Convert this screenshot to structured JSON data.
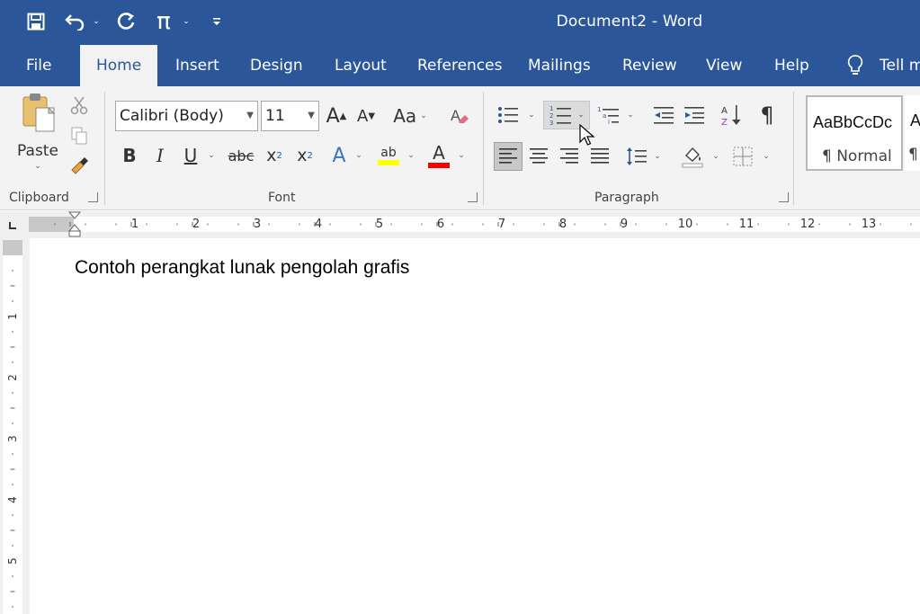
{
  "window": {
    "title": "Document2  -  Word",
    "accent": "#2b579a"
  },
  "qat": {
    "save_icon": "save-icon",
    "undo_icon": "undo-icon",
    "redo_icon": "repeat-icon",
    "equation_label": "π",
    "customize_icon": "customize-qat-icon"
  },
  "tabs": [
    {
      "label": "File"
    },
    {
      "label": "Home"
    },
    {
      "label": "Insert"
    },
    {
      "label": "Design"
    },
    {
      "label": "Layout"
    },
    {
      "label": "References"
    },
    {
      "label": "Mailings"
    },
    {
      "label": "Review"
    },
    {
      "label": "View"
    },
    {
      "label": "Help"
    },
    {
      "label": "Tell m"
    }
  ],
  "clipboard": {
    "paste_label": "Paste",
    "group_label": "Clipboard"
  },
  "font": {
    "font_name": "Calibri (Body)",
    "font_size": "11",
    "change_case": "Aa",
    "bold": "B",
    "italic": "I",
    "underline": "U",
    "strike": "abc",
    "subscript": "x",
    "subscript_mark": "2",
    "superscript": "x",
    "superscript_mark": "2",
    "text_effects": "A",
    "highlight": "ab",
    "font_color": "A",
    "highlight_color": "#ffff00",
    "font_color_value": "#ff0000",
    "group_label": "Font"
  },
  "paragraph": {
    "group_label": "Paragraph",
    "show_marks": "¶"
  },
  "styles": {
    "items": [
      {
        "preview": "AaBbCcDc",
        "name": "¶ Normal"
      },
      {
        "preview": "A",
        "name": "¶"
      }
    ]
  },
  "ruler": {
    "horizontal_numbers": [
      "1",
      "2",
      "3",
      "4",
      "5",
      "6",
      "7",
      "8",
      "9",
      "10",
      "11",
      "12",
      "13"
    ],
    "vertical_numbers": [
      "1",
      "2",
      "3",
      "4",
      "5"
    ]
  },
  "document": {
    "text": "Contoh perangkat lunak pengolah grafis"
  }
}
